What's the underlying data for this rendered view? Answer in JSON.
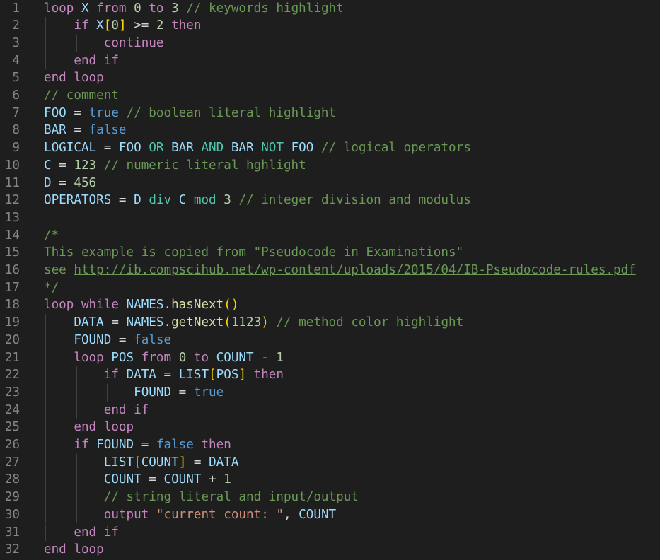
{
  "editor": {
    "indent_unit": "    ",
    "lines": [
      {
        "n": "1",
        "indent": 0,
        "tokens": [
          [
            "kw",
            "loop"
          ],
          [
            "txt",
            " "
          ],
          [
            "id",
            "X"
          ],
          [
            "txt",
            " "
          ],
          [
            "kw",
            "from"
          ],
          [
            "txt",
            " "
          ],
          [
            "num",
            "0"
          ],
          [
            "txt",
            " "
          ],
          [
            "kw",
            "to"
          ],
          [
            "txt",
            " "
          ],
          [
            "num",
            "3"
          ],
          [
            "txt",
            " "
          ],
          [
            "cmt",
            "// keywords highlight"
          ]
        ]
      },
      {
        "n": "2",
        "indent": 1,
        "tokens": [
          [
            "kw",
            "if"
          ],
          [
            "txt",
            " "
          ],
          [
            "id",
            "X"
          ],
          [
            "brk",
            "["
          ],
          [
            "num",
            "0"
          ],
          [
            "brk",
            "]"
          ],
          [
            "txt",
            " >= "
          ],
          [
            "num",
            "2"
          ],
          [
            "txt",
            " "
          ],
          [
            "kw",
            "then"
          ]
        ]
      },
      {
        "n": "3",
        "indent": 2,
        "tokens": [
          [
            "kw",
            "continue"
          ]
        ]
      },
      {
        "n": "4",
        "indent": 1,
        "tokens": [
          [
            "kw",
            "end"
          ],
          [
            "txt",
            " "
          ],
          [
            "kw",
            "if"
          ]
        ]
      },
      {
        "n": "5",
        "indent": 0,
        "tokens": [
          [
            "kw",
            "end"
          ],
          [
            "txt",
            " "
          ],
          [
            "kw",
            "loop"
          ]
        ]
      },
      {
        "n": "6",
        "indent": 0,
        "tokens": [
          [
            "cmt",
            "// comment"
          ]
        ]
      },
      {
        "n": "7",
        "indent": 0,
        "tokens": [
          [
            "id",
            "FOO"
          ],
          [
            "txt",
            " = "
          ],
          [
            "lit",
            "true"
          ],
          [
            "txt",
            " "
          ],
          [
            "cmt",
            "// boolean literal highlight"
          ]
        ]
      },
      {
        "n": "8",
        "indent": 0,
        "tokens": [
          [
            "id",
            "BAR"
          ],
          [
            "txt",
            " = "
          ],
          [
            "lit",
            "false"
          ]
        ]
      },
      {
        "n": "9",
        "indent": 0,
        "tokens": [
          [
            "id",
            "LOGICAL"
          ],
          [
            "txt",
            " = "
          ],
          [
            "id",
            "FOO"
          ],
          [
            "txt",
            " "
          ],
          [
            "op",
            "OR"
          ],
          [
            "txt",
            " "
          ],
          [
            "id",
            "BAR"
          ],
          [
            "txt",
            " "
          ],
          [
            "op",
            "AND"
          ],
          [
            "txt",
            " "
          ],
          [
            "id",
            "BAR"
          ],
          [
            "txt",
            " "
          ],
          [
            "op",
            "NOT"
          ],
          [
            "txt",
            " "
          ],
          [
            "id",
            "FOO"
          ],
          [
            "txt",
            " "
          ],
          [
            "cmt",
            "// logical operators"
          ]
        ]
      },
      {
        "n": "10",
        "indent": 0,
        "tokens": [
          [
            "id",
            "C"
          ],
          [
            "txt",
            " = "
          ],
          [
            "num",
            "123"
          ],
          [
            "txt",
            " "
          ],
          [
            "cmt",
            "// numeric literal hghlight"
          ]
        ]
      },
      {
        "n": "11",
        "indent": 0,
        "tokens": [
          [
            "id",
            "D"
          ],
          [
            "txt",
            " = "
          ],
          [
            "num",
            "456"
          ]
        ]
      },
      {
        "n": "12",
        "indent": 0,
        "tokens": [
          [
            "id",
            "OPERATORS"
          ],
          [
            "txt",
            " = "
          ],
          [
            "id",
            "D"
          ],
          [
            "txt",
            " "
          ],
          [
            "op",
            "div"
          ],
          [
            "txt",
            " "
          ],
          [
            "id",
            "C"
          ],
          [
            "txt",
            " "
          ],
          [
            "op",
            "mod"
          ],
          [
            "txt",
            " "
          ],
          [
            "num",
            "3"
          ],
          [
            "txt",
            " "
          ],
          [
            "cmt",
            "// integer division and modulus"
          ]
        ]
      },
      {
        "n": "13",
        "indent": 0,
        "tokens": []
      },
      {
        "n": "14",
        "indent": 0,
        "tokens": [
          [
            "cmt",
            "/*"
          ]
        ]
      },
      {
        "n": "15",
        "indent": 0,
        "tokens": [
          [
            "cmt",
            "This example is copied from \"Pseudocode in Examinations\""
          ]
        ]
      },
      {
        "n": "16",
        "indent": 0,
        "tokens": [
          [
            "cmt",
            "see "
          ],
          [
            "url",
            "http://ib.compscihub.net/wp-content/uploads/2015/04/IB-Pseudocode-rules.pdf"
          ]
        ]
      },
      {
        "n": "17",
        "indent": 0,
        "tokens": [
          [
            "cmt",
            "*/"
          ]
        ]
      },
      {
        "n": "18",
        "indent": 0,
        "tokens": [
          [
            "kw",
            "loop"
          ],
          [
            "txt",
            " "
          ],
          [
            "kw",
            "while"
          ],
          [
            "txt",
            " "
          ],
          [
            "id",
            "NAMES"
          ],
          [
            "txt",
            "."
          ],
          [
            "fn",
            "hasNext"
          ],
          [
            "brk",
            "()"
          ]
        ]
      },
      {
        "n": "19",
        "indent": 1,
        "tokens": [
          [
            "id",
            "DATA"
          ],
          [
            "txt",
            " = "
          ],
          [
            "id",
            "NAMES"
          ],
          [
            "txt",
            "."
          ],
          [
            "fn",
            "getNext"
          ],
          [
            "brk",
            "("
          ],
          [
            "num",
            "1123"
          ],
          [
            "brk",
            ")"
          ],
          [
            "txt",
            " "
          ],
          [
            "cmt",
            "// method color highlight"
          ]
        ]
      },
      {
        "n": "20",
        "indent": 1,
        "tokens": [
          [
            "id",
            "FOUND"
          ],
          [
            "txt",
            " = "
          ],
          [
            "lit",
            "false"
          ]
        ]
      },
      {
        "n": "21",
        "indent": 1,
        "tokens": [
          [
            "kw",
            "loop"
          ],
          [
            "txt",
            " "
          ],
          [
            "id",
            "POS"
          ],
          [
            "txt",
            " "
          ],
          [
            "kw",
            "from"
          ],
          [
            "txt",
            " "
          ],
          [
            "num",
            "0"
          ],
          [
            "txt",
            " "
          ],
          [
            "kw",
            "to"
          ],
          [
            "txt",
            " "
          ],
          [
            "id",
            "COUNT"
          ],
          [
            "txt",
            " - "
          ],
          [
            "num",
            "1"
          ]
        ]
      },
      {
        "n": "22",
        "indent": 2,
        "tokens": [
          [
            "kw",
            "if"
          ],
          [
            "txt",
            " "
          ],
          [
            "id",
            "DATA"
          ],
          [
            "txt",
            " = "
          ],
          [
            "id",
            "LIST"
          ],
          [
            "brk",
            "["
          ],
          [
            "id",
            "POS"
          ],
          [
            "brk",
            "]"
          ],
          [
            "txt",
            " "
          ],
          [
            "kw",
            "then"
          ]
        ]
      },
      {
        "n": "23",
        "indent": 3,
        "tokens": [
          [
            "id",
            "FOUND"
          ],
          [
            "txt",
            " = "
          ],
          [
            "lit",
            "true"
          ]
        ]
      },
      {
        "n": "24",
        "indent": 2,
        "tokens": [
          [
            "kw",
            "end"
          ],
          [
            "txt",
            " "
          ],
          [
            "kw",
            "if"
          ]
        ]
      },
      {
        "n": "25",
        "indent": 1,
        "tokens": [
          [
            "kw",
            "end"
          ],
          [
            "txt",
            " "
          ],
          [
            "kw",
            "loop"
          ]
        ]
      },
      {
        "n": "26",
        "indent": 1,
        "tokens": [
          [
            "kw",
            "if"
          ],
          [
            "txt",
            " "
          ],
          [
            "id",
            "FOUND"
          ],
          [
            "txt",
            " = "
          ],
          [
            "lit",
            "false"
          ],
          [
            "txt",
            " "
          ],
          [
            "kw",
            "then"
          ]
        ]
      },
      {
        "n": "27",
        "indent": 2,
        "tokens": [
          [
            "id",
            "LIST"
          ],
          [
            "brk",
            "["
          ],
          [
            "id",
            "COUNT"
          ],
          [
            "brk",
            "]"
          ],
          [
            "txt",
            " = "
          ],
          [
            "id",
            "DATA"
          ]
        ]
      },
      {
        "n": "28",
        "indent": 2,
        "tokens": [
          [
            "id",
            "COUNT"
          ],
          [
            "txt",
            " = "
          ],
          [
            "id",
            "COUNT"
          ],
          [
            "txt",
            " + "
          ],
          [
            "num",
            "1"
          ]
        ]
      },
      {
        "n": "29",
        "indent": 2,
        "tokens": [
          [
            "cmt",
            "// string literal and input/output"
          ]
        ]
      },
      {
        "n": "30",
        "indent": 2,
        "tokens": [
          [
            "kw",
            "output"
          ],
          [
            "txt",
            " "
          ],
          [
            "str",
            "\"current count: \""
          ],
          [
            "txt",
            ", "
          ],
          [
            "id",
            "COUNT"
          ]
        ]
      },
      {
        "n": "31",
        "indent": 1,
        "tokens": [
          [
            "kw",
            "end"
          ],
          [
            "txt",
            " "
          ],
          [
            "kw",
            "if"
          ]
        ]
      },
      {
        "n": "32",
        "indent": 0,
        "tokens": [
          [
            "kw",
            "end"
          ],
          [
            "txt",
            " "
          ],
          [
            "kw",
            "loop"
          ]
        ]
      }
    ]
  }
}
